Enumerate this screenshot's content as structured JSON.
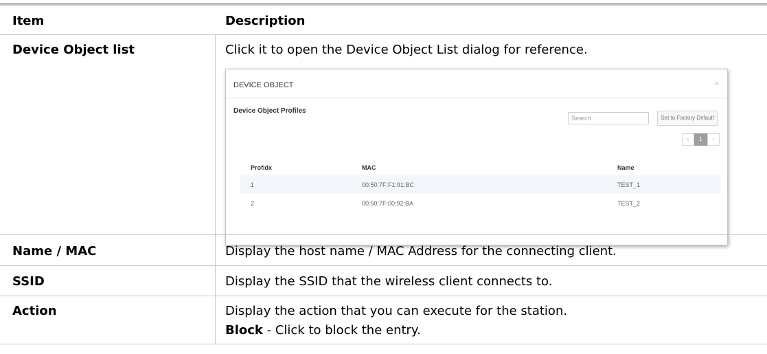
{
  "table": {
    "header": {
      "item": "Item",
      "description": "Description"
    },
    "rows": [
      {
        "item": "Device Object list",
        "description": "Click it to open the Device Object List dialog for reference."
      },
      {
        "item": "Name / MAC",
        "description": "Display the host name / MAC Address for the connecting client."
      },
      {
        "item": "SSID",
        "description": "Display the SSID that the wireless client connects to."
      },
      {
        "item": "Action",
        "description": "Display the action that you can execute for the station.",
        "note_bold": "Block",
        "note_rest": " - Click to block the entry."
      }
    ]
  },
  "dialog": {
    "title": "DEVICE OBJECT",
    "close": "×",
    "subtitle": "Device Object Profiles",
    "search_placeholder": "Search",
    "reset_button": "Set to Factory Default",
    "pagination": {
      "prev": "‹",
      "current": "1",
      "next": "›"
    },
    "columns": [
      "Profidx",
      "MAC",
      "Name"
    ],
    "rows": [
      {
        "profidx": "1",
        "mac": "00:50:7F:F1:91:BC",
        "name": "TEST_1"
      },
      {
        "profidx": "2",
        "mac": "00:50:7F:00:92:BA",
        "name": "TEST_2"
      }
    ]
  }
}
